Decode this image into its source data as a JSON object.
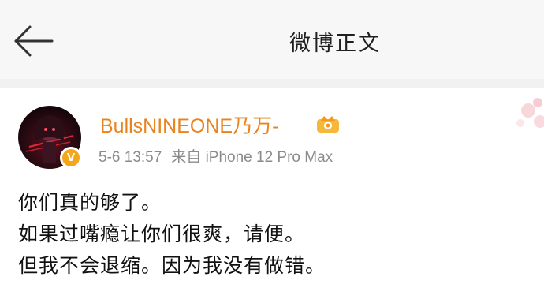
{
  "header": {
    "title": "微博正文",
    "back_icon": "back-arrow-icon"
  },
  "post": {
    "username": "BullsNINEONE乃万-",
    "timestamp": "5-6 13:57",
    "source": "来自 iPhone 12 Pro Max",
    "verified_badge": "V",
    "content_lines": [
      "你们真的够了。",
      "如果过嘴瘾让你们很爽，请便。",
      "但我不会退缩。因为我没有做错。"
    ]
  },
  "colors": {
    "username": "#e8841f",
    "meta": "#8b8b8b",
    "badge": "#f4a61a",
    "header_bg": "#f7f7f7"
  }
}
